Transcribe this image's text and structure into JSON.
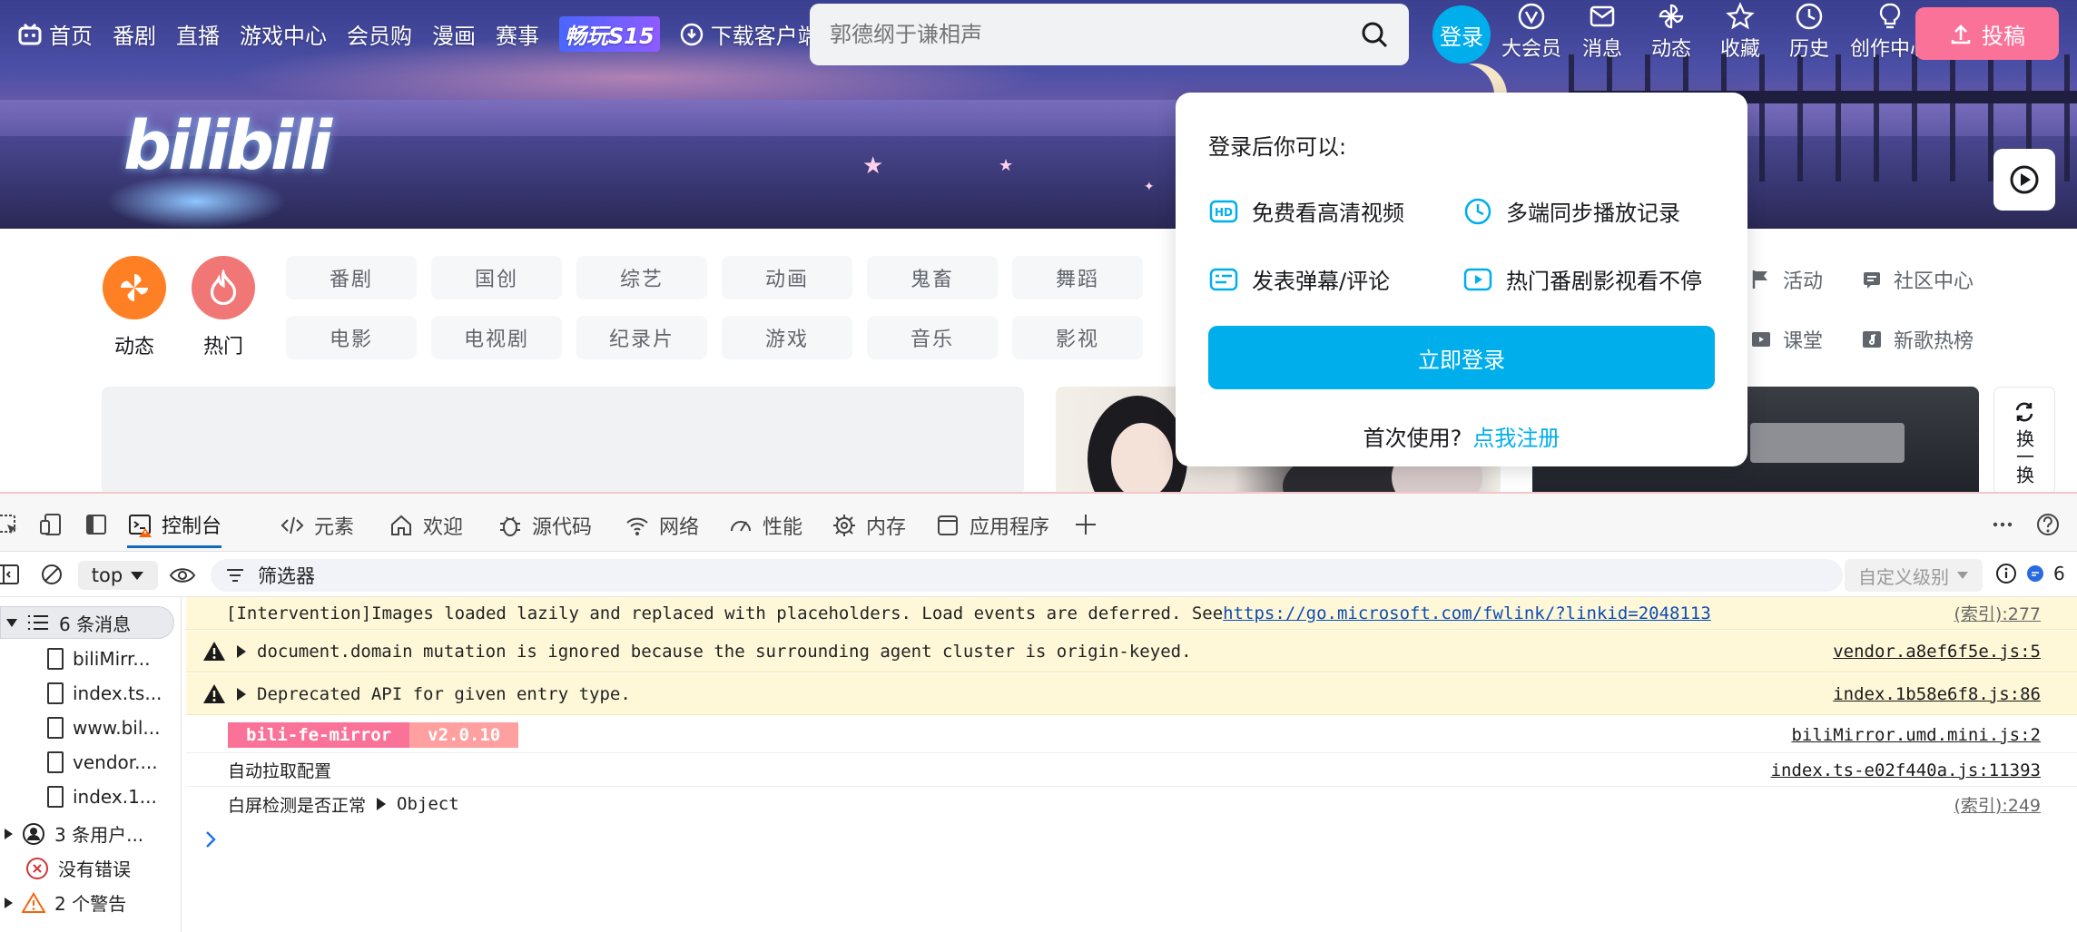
{
  "topnav": {
    "items": [
      {
        "label": "首页",
        "icon": "tv-icon"
      },
      {
        "label": "番剧"
      },
      {
        "label": "直播"
      },
      {
        "label": "游戏中心"
      },
      {
        "label": "会员购"
      },
      {
        "label": "漫画"
      },
      {
        "label": "赛事"
      },
      {
        "label": "畅玩S15",
        "promo": true
      },
      {
        "label": "下载客户端",
        "icon": "download-icon"
      }
    ],
    "search_placeholder": "郭德纲于谦相声",
    "login_label": "登录",
    "right_items": [
      {
        "label": "大会员",
        "icon": "vip-icon"
      },
      {
        "label": "消息",
        "icon": "mail-icon"
      },
      {
        "label": "动态",
        "icon": "windmill-icon"
      },
      {
        "label": "收藏",
        "icon": "star-icon"
      },
      {
        "label": "历史",
        "icon": "clock-icon"
      },
      {
        "label": "创作中心",
        "icon": "bulb-icon"
      }
    ],
    "upload_label": "投稿"
  },
  "banner": {
    "logo_text": "bilibili"
  },
  "channels": {
    "round": [
      {
        "label": "动态",
        "color": "#ff7f24"
      },
      {
        "label": "热门",
        "color": "#f07775"
      }
    ],
    "row1": [
      "番剧",
      "国创",
      "综艺",
      "动画",
      "鬼畜",
      "舞蹈"
    ],
    "row2": [
      "电影",
      "电视剧",
      "纪录片",
      "游戏",
      "音乐",
      "影视"
    ],
    "side": [
      {
        "label": "活动",
        "icon": "flag-icon"
      },
      {
        "label": "社区中心",
        "icon": "community-icon"
      },
      {
        "label": "课堂",
        "icon": "class-icon"
      },
      {
        "label": "新歌热榜",
        "icon": "music-chart-icon"
      }
    ],
    "refresh_label": "换一换"
  },
  "popup": {
    "title": "登录后你可以:",
    "features": [
      {
        "label": "免费看高清视频",
        "icon": "hd-icon"
      },
      {
        "label": "多端同步播放记录",
        "icon": "clock-icon"
      },
      {
        "label": "发表弹幕/评论",
        "icon": "danmaku-icon"
      },
      {
        "label": "热门番剧影视看不停",
        "icon": "play-icon"
      }
    ],
    "login_button": "立即登录",
    "register_prompt": "首次使用?",
    "register_link": "点我注册"
  },
  "devtools": {
    "tabs": [
      {
        "label": "控制台",
        "icon": "console-icon",
        "active": true
      },
      {
        "label": "元素",
        "icon": "code-icon"
      },
      {
        "label": "欢迎",
        "icon": "home-icon"
      },
      {
        "label": "源代码",
        "icon": "bug-icon"
      },
      {
        "label": "网络",
        "icon": "wifi-icon"
      },
      {
        "label": "性能",
        "icon": "gauge-icon"
      },
      {
        "label": "内存",
        "icon": "chip-icon"
      },
      {
        "label": "应用程序",
        "icon": "app-icon"
      }
    ],
    "context": "top",
    "filter_label": "筛选器",
    "level_label": "自定义级别",
    "message_count": "6",
    "sidebar": [
      {
        "label": "6 条消息",
        "icon": "list-icon"
      },
      {
        "label": "biliMirr...",
        "icon": "file-icon"
      },
      {
        "label": "index.ts...",
        "icon": "file-icon"
      },
      {
        "label": "www.bil...",
        "icon": "file-icon"
      },
      {
        "label": "vendor....",
        "icon": "file-icon"
      },
      {
        "label": "index.1...",
        "icon": "file-icon"
      },
      {
        "label": "3 条用户...",
        "icon": "user-icon"
      },
      {
        "label": "没有错误",
        "icon": "error-icon"
      },
      {
        "label": "2 个警告",
        "icon": "warning-icon"
      }
    ],
    "messages": [
      {
        "text": "[Intervention]Images loaded lazily and replaced with placeholders. Load events are deferred. See ",
        "link": "https://go.microsoft.com/fwlink/?linkid=2048113",
        "source": "(索引):277",
        "type": "intervention"
      },
      {
        "text": "document.domain mutation is ignored because the surrounding agent cluster is origin-keyed.",
        "source": "vendor.a8ef6f5e.js:5",
        "type": "warning"
      },
      {
        "text": "Deprecated API for given entry type.",
        "source": "index.1b58e6f8.js:86",
        "type": "warning"
      },
      {
        "badge1": "bili-fe-mirror",
        "badge2": "v2.0.10",
        "source": "biliMirror.umd.mini.js:2",
        "type": "log"
      },
      {
        "text": "自动拉取配置",
        "source": "index.ts-e02f440a.js:11393",
        "type": "log"
      },
      {
        "text": "白屏检测是否正常",
        "object": "Object",
        "source": "(索引):249",
        "type": "log"
      }
    ]
  }
}
